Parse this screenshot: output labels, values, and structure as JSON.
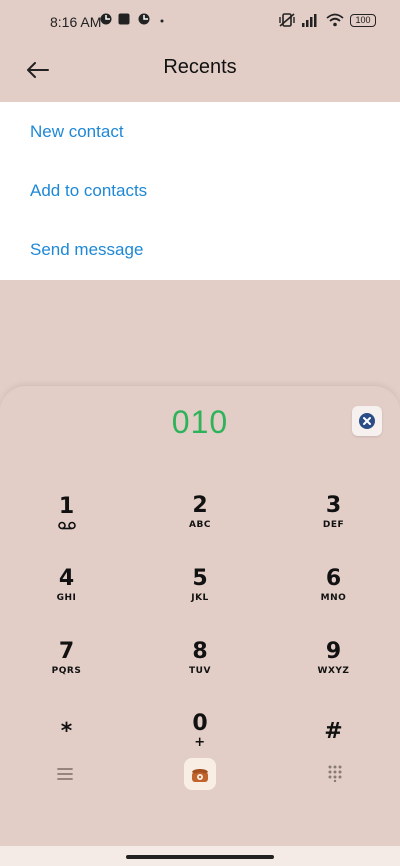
{
  "status": {
    "time": "8:16 AM",
    "battery": "100"
  },
  "header": {
    "title": "Recents"
  },
  "menu": {
    "items": [
      {
        "label": "New contact"
      },
      {
        "label": "Add to contacts"
      },
      {
        "label": "Send message"
      }
    ]
  },
  "dialer": {
    "number": "010",
    "keys": [
      {
        "digit": "1",
        "letters": ""
      },
      {
        "digit": "2",
        "letters": "ABC"
      },
      {
        "digit": "3",
        "letters": "DEF"
      },
      {
        "digit": "4",
        "letters": "GHI"
      },
      {
        "digit": "5",
        "letters": "JKL"
      },
      {
        "digit": "6",
        "letters": "MNO"
      },
      {
        "digit": "7",
        "letters": "PQRS"
      },
      {
        "digit": "8",
        "letters": "TUV"
      },
      {
        "digit": "9",
        "letters": "WXYZ"
      },
      {
        "digit": "*",
        "letters": ""
      },
      {
        "digit": "0",
        "letters": "+"
      },
      {
        "digit": "#",
        "letters": ""
      }
    ]
  },
  "colors": {
    "accent_link": "#1e88d6",
    "number_green": "#2fb35a",
    "background": "#e3cec7",
    "call_icon": "#c0642b"
  },
  "icons": {
    "back": "arrow-left-icon",
    "delete": "backspace-x-icon",
    "call": "phone-call-icon",
    "menu": "menu-lines-icon",
    "keypad": "keypad-grid-icon",
    "voicemail": "voicemail-icon"
  }
}
